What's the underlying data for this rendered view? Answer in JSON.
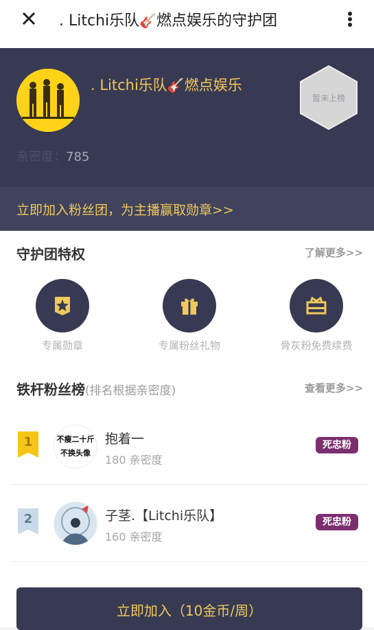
{
  "topbar": {
    "title_prefix": ". Litchi乐队",
    "title_emoji": "🎸",
    "title_suffix": "燃点娱乐的守护团",
    "close_icon": "close-icon",
    "more_icon": "more-vertical-icon"
  },
  "hero": {
    "name_prefix": ". Litchi乐队",
    "name_emoji": "🎸",
    "name_suffix": "燃点娱乐",
    "rank_badge": "暂未上榜",
    "intimacy_label": "亲密度：",
    "intimacy_value": "785"
  },
  "join_banner": "立即加入粉丝团，为主播赢取勋章>>",
  "privileges": {
    "title": "守护团特权",
    "more": "了解更多>>",
    "items": [
      {
        "label": "专属勋章",
        "icon": "badge-star-icon"
      },
      {
        "label": "专属粉丝礼物",
        "icon": "gift-icon"
      },
      {
        "label": "骨灰粉免费续费",
        "icon": "ticket-icon"
      }
    ]
  },
  "leaderboard": {
    "title": "铁杆粉丝榜",
    "note": "(排名根据亲密度)",
    "more": "查看更多>>",
    "rows": [
      {
        "rank": "1",
        "name": "抱着一",
        "score": "180 亲密度",
        "badge": "死忠粉",
        "avatar_text_1": "不瘦二十斤",
        "avatar_text_2": "不换头像"
      },
      {
        "rank": "2",
        "name": "子茎.【Litchi乐队】",
        "score": "160 亲密度",
        "badge": "死忠粉"
      }
    ]
  },
  "cta_label": "立即加入（10金币/周）",
  "colors": {
    "navy": "#373a52",
    "gold": "#f0c85c",
    "badge_purple": "#7b2f6e",
    "rank1": "#f5c518",
    "rank2": "#c9dbe8"
  }
}
